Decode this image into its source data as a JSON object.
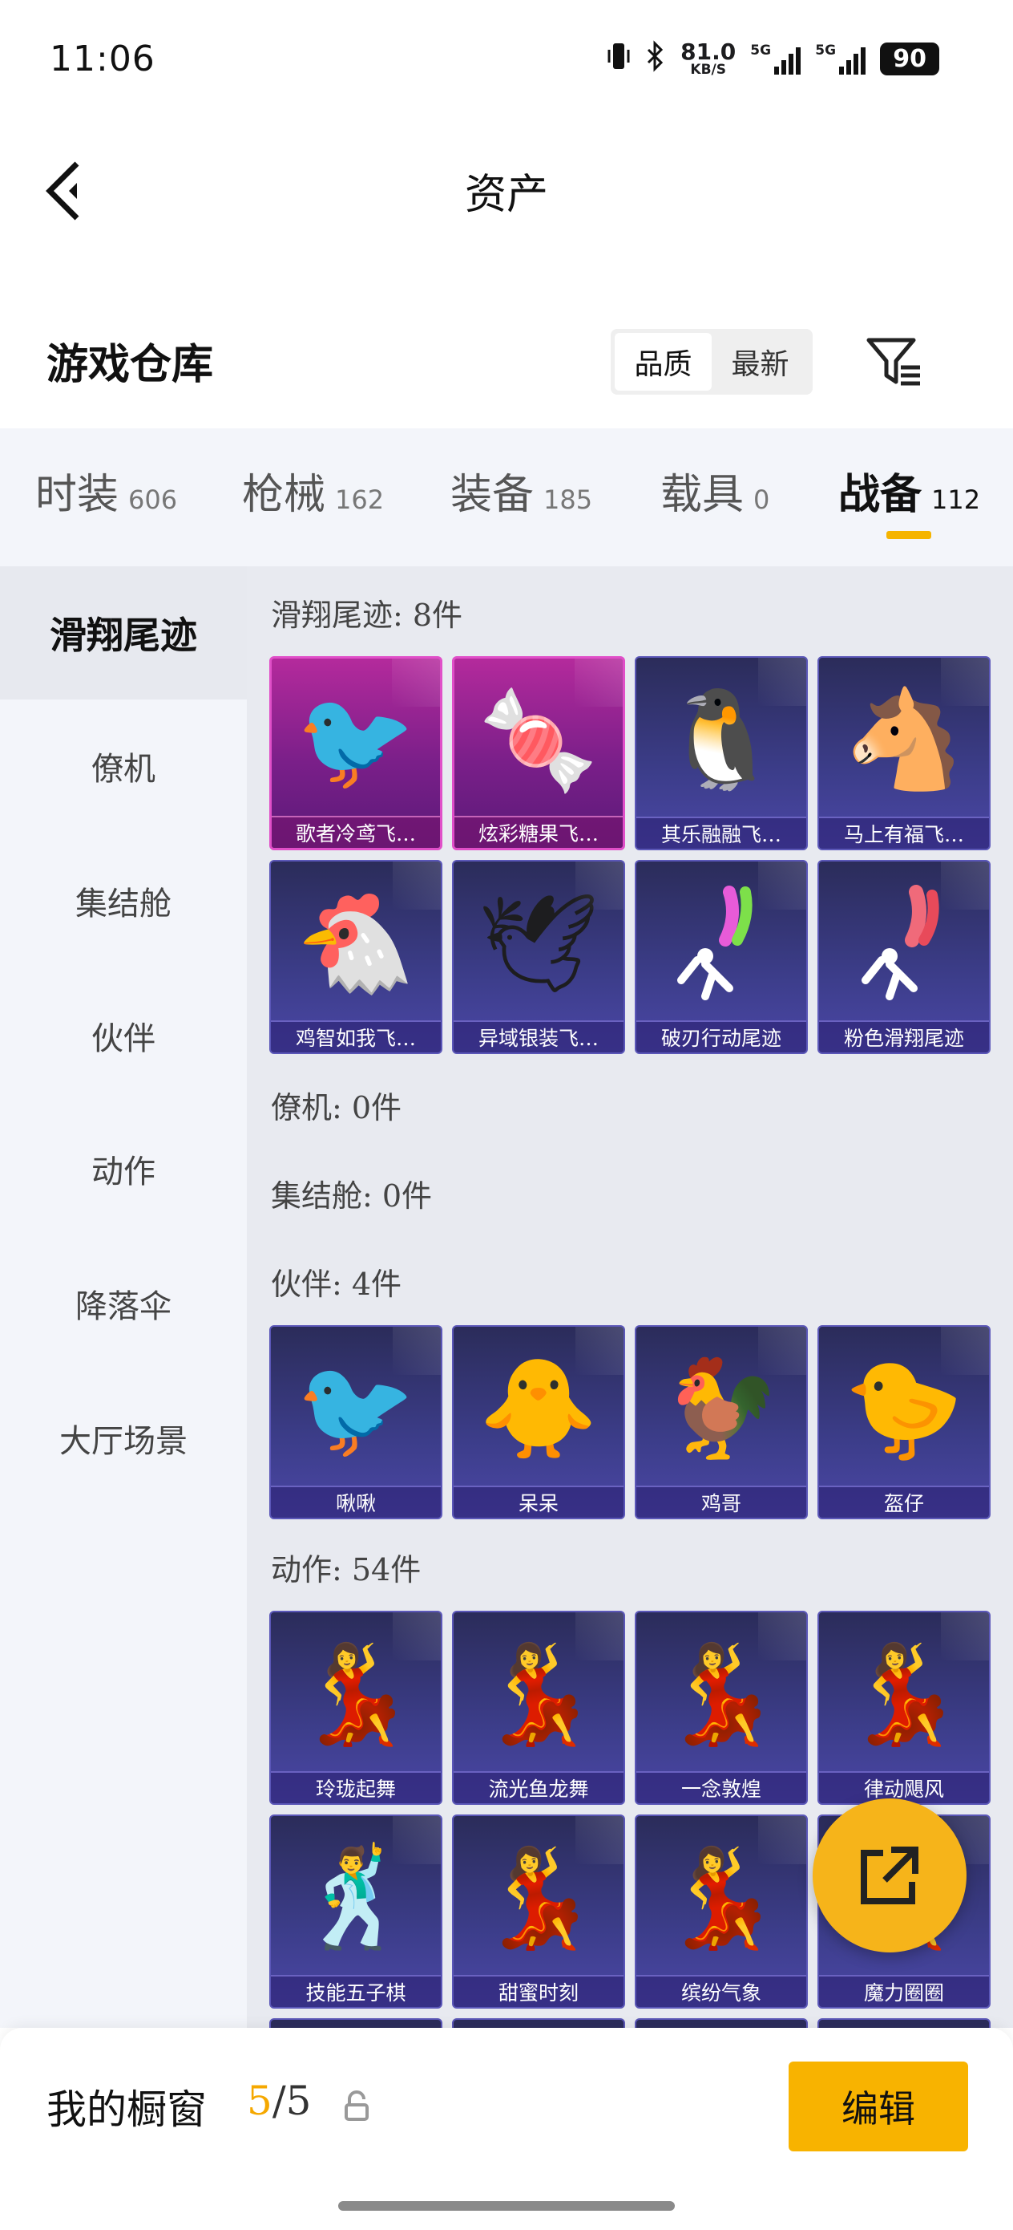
{
  "status_bar": {
    "time": "11:06",
    "net_speed": "81.0",
    "net_unit": "KB/S",
    "sig1": "5G",
    "sig2": "5G",
    "battery": "90"
  },
  "header": {
    "title": "资产"
  },
  "repo": {
    "title": "游戏仓库",
    "sort_quality": "品质",
    "sort_newest": "最新"
  },
  "tabs": [
    {
      "label": "时装",
      "count": "606"
    },
    {
      "label": "枪械",
      "count": "162"
    },
    {
      "label": "装备",
      "count": "185"
    },
    {
      "label": "载具",
      "count": "0"
    },
    {
      "label": "战备",
      "count": "112"
    }
  ],
  "sidebar": [
    "滑翔尾迹",
    "僚机",
    "集结舱",
    "伙伴",
    "动作",
    "降落伞",
    "大厅场景"
  ],
  "sections": {
    "glide": "滑翔尾迹: 8件",
    "wingman": "僚机: 0件",
    "pod": "集结舱: 0件",
    "partner": "伙伴: 4件",
    "emote": "动作: 54件"
  },
  "items": {
    "glide": [
      {
        "name": "歌者冷鸢飞…",
        "icon": "red-bird-icon"
      },
      {
        "name": "炫彩糖果飞…",
        "icon": "candy-icon"
      },
      {
        "name": "其乐融融飞…",
        "icon": "penguin-icon"
      },
      {
        "name": "马上有福飞…",
        "icon": "horse-icon"
      },
      {
        "name": "鸡智如我飞…",
        "icon": "chicken-icon"
      },
      {
        "name": "异域银装飞…",
        "icon": "wing-icon"
      },
      {
        "name": "破刃行动尾迹",
        "icon": "smoke-trail-icon"
      },
      {
        "name": "粉色滑翔尾迹",
        "icon": "pink-trail-icon"
      }
    ],
    "partner": [
      {
        "name": "啾啾",
        "icon": "pink-bird-icon"
      },
      {
        "name": "呆呆",
        "icon": "chick-icon"
      },
      {
        "name": "鸡哥",
        "icon": "rooster-icon"
      },
      {
        "name": "盔仔",
        "icon": "helmet-chick-icon"
      }
    ],
    "emote": [
      {
        "name": "玲珑起舞",
        "icon": "dance-icon"
      },
      {
        "name": "流光鱼龙舞",
        "icon": "dance-icon"
      },
      {
        "name": "一念敦煌",
        "icon": "dance-icon"
      },
      {
        "name": "律动飓风",
        "icon": "dance-icon"
      },
      {
        "name": "技能五子棋",
        "icon": "dance-icon"
      },
      {
        "name": "甜蜜时刻",
        "icon": "dance-icon"
      },
      {
        "name": "缤纷气象",
        "icon": "dance-icon"
      },
      {
        "name": "魔力圈圈",
        "icon": "dance-icon"
      }
    ]
  },
  "bottom": {
    "label": "我的橱窗",
    "current": "5",
    "total": "/5",
    "edit": "编辑"
  },
  "colors": {
    "accent": "#f8b300",
    "pink_card": "#b42a9c",
    "blue_card": "#3c3d8a"
  }
}
